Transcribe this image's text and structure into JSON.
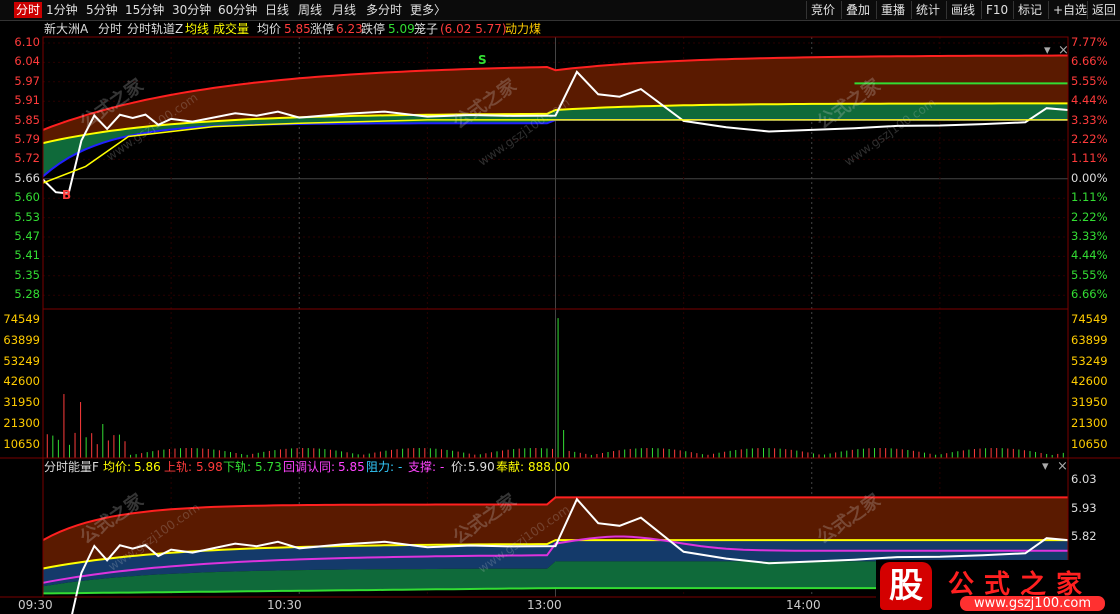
{
  "toolbar": {
    "tabs": [
      "分时",
      "1分钟",
      "5分钟",
      "15分钟",
      "30分钟",
      "60分钟",
      "日线",
      "周线",
      "月线",
      "多分时",
      "更多〉"
    ],
    "right": [
      "竞价",
      "叠加",
      "重播",
      "统计",
      "画线",
      "F10",
      "标记",
      "+自选",
      "返回"
    ]
  },
  "main_info": {
    "stock": "新大洲A",
    "p1": "分时",
    "p2": "分时轨道Z",
    "avg_line": "均线",
    "volume": "成交量",
    "avg_label": "均价",
    "avg_value": "5.85",
    "limit_up_label": "涨停",
    "limit_up_value": "6.23",
    "limit_down_label": "跌停",
    "limit_down_value": "5.09",
    "cage_label": "笼子",
    "cage_value": "(6.02 5.77)",
    "concept": "动力煤"
  },
  "sub_info": {
    "name": "分时能量F",
    "avg_label": "均价:",
    "avg_value": "5.86",
    "upper_label": "上轨:",
    "upper_value": "5.98",
    "lower_label": "下轨:",
    "lower_value": "5.73",
    "pullback_label": "回调认同:",
    "pullback_value": "5.85",
    "resist_label": "阻力:",
    "resist_value": "-",
    "support_label": "支撑:",
    "support_value": "-",
    "price_label": "价:",
    "price_value": "5.90",
    "dedicate_label": "奉献:",
    "dedicate_value": "888.00"
  },
  "markers": {
    "b": "B",
    "s": "S"
  },
  "watermark": {
    "text": "公式之家",
    "url": "www.gszj100.com"
  },
  "logo": {
    "char": "股",
    "name": "公式之家",
    "url": "www.gszj100.com"
  },
  "colors": {
    "up": "#ff3b3b",
    "down": "#33dd33",
    "avg": "#ffff00",
    "accent": "#cc0000"
  },
  "chart_data": [
    {
      "type": "line",
      "name": "price-panel",
      "y_left_ticks": [
        "6.10",
        "6.04",
        "5.97",
        "5.91",
        "5.85",
        "5.79",
        "5.72",
        "5.66",
        "5.60",
        "5.53",
        "5.47",
        "5.41",
        "5.35",
        "5.28"
      ],
      "y_right_ticks": [
        "7.77%",
        "6.66%",
        "5.55%",
        "4.44%",
        "3.33%",
        "2.22%",
        "1.11%",
        "0.00%",
        "1.11%",
        "2.22%",
        "3.33%",
        "4.44%",
        "5.55%",
        "6.66%"
      ],
      "ylim": [
        5.28,
        6.1
      ],
      "prev_close": 5.66,
      "series": [
        {
          "name": "price",
          "x": [
            0,
            3,
            6,
            9,
            12,
            15,
            18,
            21,
            24,
            27,
            30,
            35,
            40,
            45,
            50,
            55,
            60,
            70,
            80,
            90,
            100,
            110,
            120,
            125,
            130,
            135,
            140,
            150,
            160,
            170,
            180,
            190,
            200,
            210,
            220,
            230,
            235,
            240
          ],
          "values": [
            5.67,
            5.64,
            5.63,
            5.78,
            5.86,
            5.83,
            5.87,
            5.85,
            5.86,
            5.84,
            5.86,
            5.85,
            5.86,
            5.87,
            5.86,
            5.87,
            5.85,
            5.86,
            5.87,
            5.86,
            5.87,
            5.87,
            5.87,
            6.0,
            5.93,
            5.92,
            5.94,
            5.84,
            5.82,
            5.81,
            5.82,
            5.83,
            5.84,
            5.84,
            5.84,
            5.84,
            5.88,
            5.88
          ]
        },
        {
          "name": "avg",
          "x": [
            0,
            10,
            20,
            40,
            60,
            90,
            120,
            121,
            150,
            180,
            210,
            240
          ],
          "values": [
            5.66,
            5.71,
            5.8,
            5.83,
            5.84,
            5.85,
            5.85,
            5.85,
            5.85,
            5.85,
            5.85,
            5.85
          ]
        }
      ]
    },
    {
      "type": "bar",
      "name": "volume-panel",
      "y_ticks": [
        "74549",
        "63899",
        "53249",
        "42600",
        "31950",
        "21300",
        "10650"
      ],
      "ylim": [
        0,
        74549
      ],
      "peaks": [
        {
          "x": 5,
          "value": 32000
        },
        {
          "x": 9,
          "value": 28000
        },
        {
          "x": 14,
          "value": 17000
        },
        {
          "x": 121,
          "value": 70000
        },
        {
          "x": 122,
          "value": 14000
        }
      ]
    },
    {
      "type": "line",
      "name": "energy-panel",
      "y_ticks": [
        "6.03",
        "5.93",
        "5.82"
      ],
      "ylim": [
        5.72,
        6.06
      ]
    }
  ],
  "time_axis": [
    "09:30",
    "10:30",
    "13:00",
    "14:00"
  ]
}
